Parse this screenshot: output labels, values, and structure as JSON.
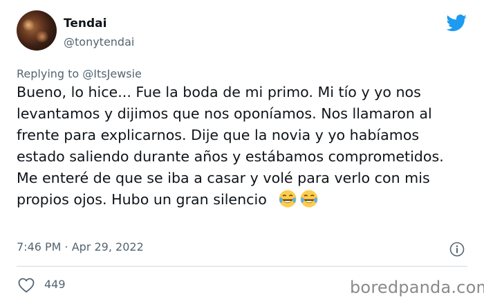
{
  "tweet": {
    "author_name": "Tendai",
    "author_handle": "@tonytendai",
    "replying_prefix": "Replying to ",
    "replying_to": "@ItsJewsie",
    "text": "Bueno, lo hice... Fue la boda de mi primo. Mi tío y yo nos levantamos y dijimos que nos oponíamos. Nos llamaron al frente para explicarnos. Dije que la novia y yo habíamos estado saliendo durante años y estábamos comprometidos. Me enteré de que se iba a casar y volé para verlo con mis propios ojos. Hubo un gran silencio",
    "emojis": [
      "face-with-tears-of-joy-icon",
      "face-with-tears-of-joy-icon"
    ],
    "timestamp": "7:46 PM · Apr 29, 2022",
    "like_count": "449"
  },
  "icons": {
    "brand": "twitter-bird-icon",
    "info": "info-icon",
    "like": "heart-icon"
  },
  "colors": {
    "twitter_blue": "#1d9bf0",
    "text_primary": "#0f1419",
    "text_secondary": "#536471",
    "divider": "#cfd9de",
    "emoji_yellow": "#ffcc4d"
  },
  "watermark": "boredpanda.com"
}
